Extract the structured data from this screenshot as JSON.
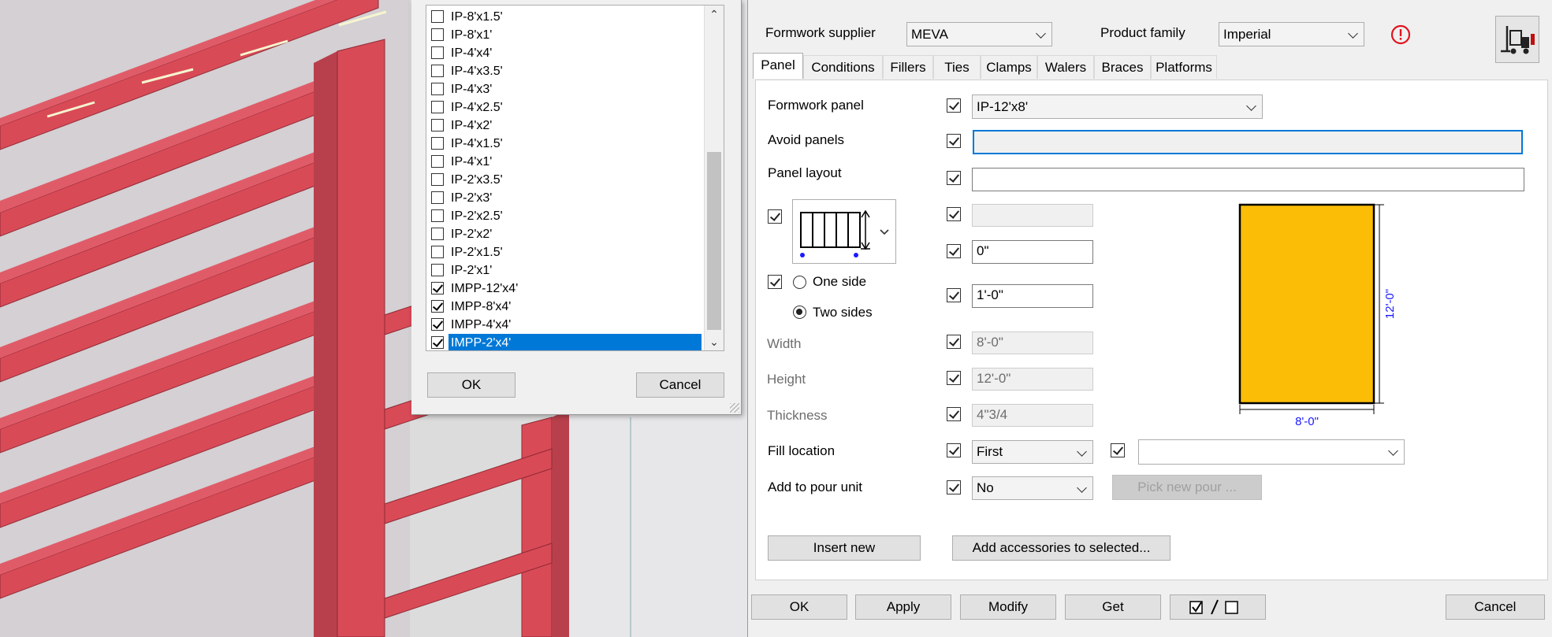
{
  "list_dialog": {
    "items": [
      {
        "label": "IP-8'x1.5'",
        "checked": false
      },
      {
        "label": "IP-8'x1'",
        "checked": false
      },
      {
        "label": "IP-4'x4'",
        "checked": false
      },
      {
        "label": "IP-4'x3.5'",
        "checked": false
      },
      {
        "label": "IP-4'x3'",
        "checked": false
      },
      {
        "label": "IP-4'x2.5'",
        "checked": false
      },
      {
        "label": "IP-4'x2'",
        "checked": false
      },
      {
        "label": "IP-4'x1.5'",
        "checked": false
      },
      {
        "label": "IP-4'x1'",
        "checked": false
      },
      {
        "label": "IP-2'x3.5'",
        "checked": false
      },
      {
        "label": "IP-2'x3'",
        "checked": false
      },
      {
        "label": "IP-2'x2.5'",
        "checked": false
      },
      {
        "label": "IP-2'x2'",
        "checked": false
      },
      {
        "label": "IP-2'x1.5'",
        "checked": false
      },
      {
        "label": "IP-2'x1'",
        "checked": false
      },
      {
        "label": "IMPP-12'x4'",
        "checked": true
      },
      {
        "label": "IMPP-8'x4'",
        "checked": true
      },
      {
        "label": "IMPP-4'x4'",
        "checked": true
      },
      {
        "label": "IMPP-2'x4'",
        "checked": true,
        "selected": true
      }
    ],
    "ok_label": "OK",
    "cancel_label": "Cancel"
  },
  "main": {
    "supplier_label": "Formwork supplier",
    "supplier_value": "MEVA",
    "family_label": "Product family",
    "family_value": "Imperial",
    "tabs": [
      "Panel",
      "Conditions",
      "Fillers",
      "Ties",
      "Clamps",
      "Walers",
      "Braces",
      "Platforms"
    ],
    "active_tab": "Panel",
    "panel": {
      "formwork_panel_label": "Formwork panel",
      "formwork_panel_value": "IP-12'x8'",
      "avoid_panels_label": "Avoid panels",
      "avoid_panels_value": "",
      "panel_layout_label": "Panel layout",
      "panel_layout_value": "",
      "offset1_value": "0\"",
      "offset2_value": "1'-0\"",
      "one_side_label": "One side",
      "two_sides_label": "Two sides",
      "width_label": "Width",
      "width_value": "8'-0\"",
      "height_label": "Height",
      "height_value": "12'-0\"",
      "thickness_label": "Thickness",
      "thickness_value": "4\"3/4",
      "fill_location_label": "Fill location",
      "fill_location_value": "First",
      "add_to_pour_label": "Add to pour unit",
      "add_to_pour_value": "No",
      "pick_pour_label": "Pick new pour ...",
      "insert_new_label": "Insert new",
      "add_accessories_label": "Add accessories to selected...",
      "preview_width_label": "8'-0\"",
      "preview_height_label": "12'-0\"",
      "preview_fill_color": "#fbbd05"
    },
    "bottom": {
      "ok": "OK",
      "apply": "Apply",
      "modify": "Modify",
      "get": "Get",
      "cancel": "Cancel"
    }
  }
}
